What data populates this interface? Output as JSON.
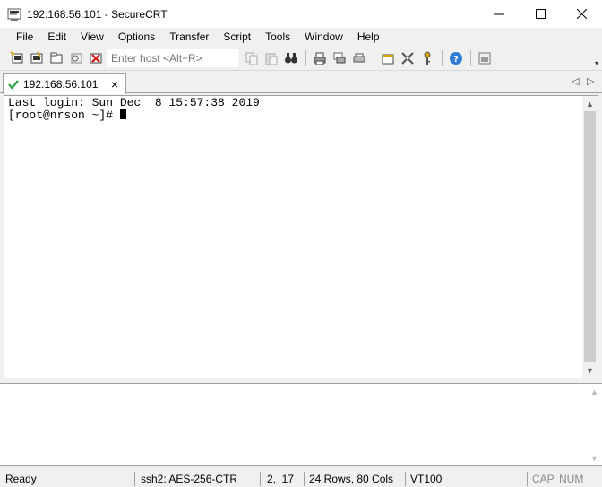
{
  "window": {
    "title": "192.168.56.101 - SecureCRT"
  },
  "menu": [
    "File",
    "Edit",
    "View",
    "Options",
    "Transfer",
    "Script",
    "Tools",
    "Window",
    "Help"
  ],
  "toolbar": {
    "host_placeholder": "Enter host <Alt+R>"
  },
  "tab": {
    "label": "192.168.56.101",
    "close": "×"
  },
  "terminal": {
    "line1": "Last login: Sun Dec  8 15:57:38 2019",
    "line2": "[root@nrson ~]# "
  },
  "status": {
    "state": "Ready",
    "cipher": "ssh2: AES-256-CTR",
    "position": "2,  17",
    "size": "24 Rows, 80 Cols",
    "emulation": "VT100",
    "cap": "CAP",
    "num": "NUM"
  },
  "colors": {
    "accent": "#2e7bd6",
    "check": "#2ea043"
  }
}
